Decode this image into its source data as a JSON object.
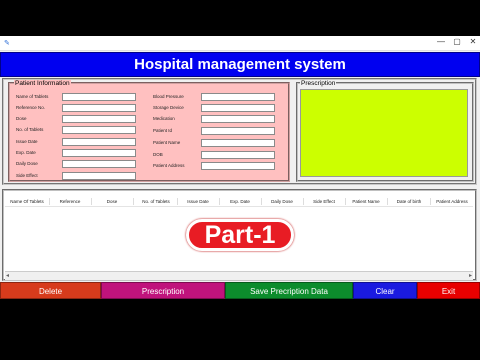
{
  "window": {
    "icon": "feather-icon",
    "controls": [
      "—",
      "▢",
      "✕"
    ]
  },
  "app": {
    "title": "Hospital management system"
  },
  "patient_info": {
    "legend": "Patient Information",
    "left_fields": [
      "Name of Tablets",
      "Reference No.",
      "Dose",
      "No. of Tablets",
      "Issue Date",
      "Exp. Date",
      "Daily Dose",
      "Side Effect"
    ],
    "right_fields": [
      "Blood Pressure",
      "Storage Device",
      "Medication",
      "Patient Id",
      "Patient Name",
      "DOB",
      "Patient Address"
    ]
  },
  "prescription": {
    "legend": "Prescription"
  },
  "table": {
    "columns": [
      "Name Of Tablets",
      "Reference",
      "Dose",
      "No. of Tablets",
      "Issue Date",
      "Exp. Date",
      "Daily Dose",
      "Side Effect",
      "Patient Name",
      "Date of birth",
      "Patient Address"
    ]
  },
  "overlay": {
    "badge": "Part-1"
  },
  "buttons": {
    "delete": "Delete",
    "prescription": "Prescription",
    "save": "Save Precription Data",
    "clear": "Clear",
    "exit": "Exit"
  },
  "colors": {
    "banner": "#0000f0",
    "info_bg": "#ffc0c0",
    "prescription_bg": "#ccff00",
    "delete": "#d73b1c",
    "prescription_btn": "#c0137c",
    "save": "#0c8c2c",
    "clear": "#1a1ae0",
    "exit": "#e80000",
    "badge": "#e81c24"
  }
}
